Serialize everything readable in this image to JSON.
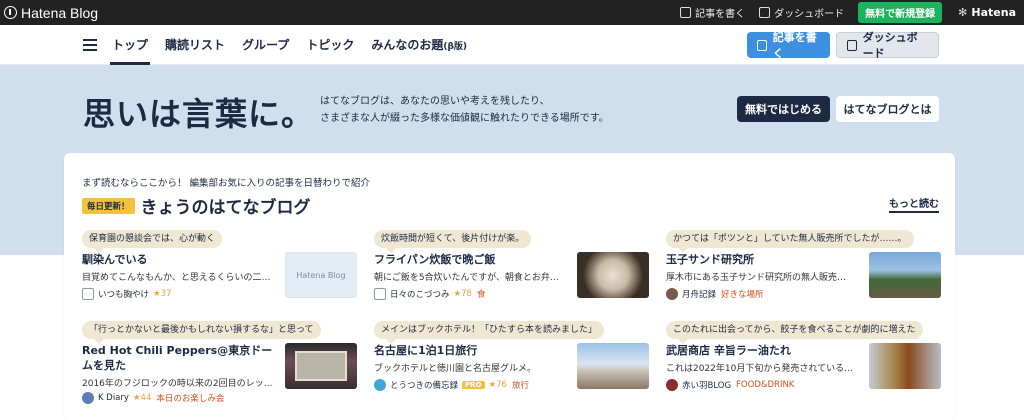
{
  "topbar": {
    "logo": "Hatena Blog",
    "write": "記事を書く",
    "dashboard": "ダッシュボード",
    "register": "無料で新規登録",
    "hatena": "Hatena"
  },
  "nav": {
    "tabs": [
      {
        "label": "トップ"
      },
      {
        "label": "購読リスト"
      },
      {
        "label": "グループ"
      },
      {
        "label": "トピック"
      },
      {
        "label": "みんなのお題",
        "suffix": "(β版)"
      }
    ],
    "write_btn": "記事を書く",
    "dash_btn": "ダッシュボード"
  },
  "hero": {
    "title": "思いは言葉に。",
    "desc1": "はてなブログは、あなたの思いや考えを残したり、",
    "desc2": "さまざまな人が綴った多様な価値観に触れたりできる場所です。",
    "btn_free": "無料ではじめる",
    "btn_about": "はてなブログとは"
  },
  "featured": {
    "intro": "まず読むならここから！ 編集部お気に入りの記事を日替わりで紹介",
    "badge": "毎日更新！",
    "heading": "きょうのはてなブログ",
    "more": "もっと読む",
    "entries": [
      {
        "comment": "保育園の懇談会では、心が動く",
        "title": "馴染んでいる",
        "desc": "目覚めてこんなもんか、と思えるくらいの二…",
        "blog": "いつも胸やけ",
        "stars": "★37",
        "pro": "",
        "category": "",
        "thumb": "Hatena Blog"
      },
      {
        "comment": "炊飯時間が短くて、後片付けが楽。",
        "title": "フライパン炊飯で晩ご飯",
        "desc": "朝にご飯を5合炊いたんですが、朝食とお弁…",
        "blog": "日々のこづつみ",
        "stars": "★78",
        "pro": "",
        "category": "食",
        "thumb": ""
      },
      {
        "comment": "かつては「ポツンと」していた無人販売所でしたが……。",
        "title": "玉子サンド研究所",
        "desc": "厚木市にある玉子サンド研究所の無人販売…",
        "blog": "月舟記録",
        "stars": "",
        "pro": "",
        "category": "好きな場所",
        "thumb": ""
      },
      {
        "comment": "「行っとかないと最後かもしれない損するな」と思って",
        "title": "Red Hot Chili Peppers@東京ドームを見た",
        "desc": "2016年のフジロックの時以来の2回目のレッ…",
        "blog": "K Diary",
        "stars": "★44",
        "pro": "",
        "category": "本日のお楽しみ会",
        "thumb": ""
      },
      {
        "comment": "メインはブックホテル！「ひたすら本を読みました」",
        "title": "名古屋に1泊1日旅行",
        "desc": "ブックホテルと徳川園と名古屋グルメ。",
        "blog": "とうつきの備忘録",
        "stars": "★76",
        "pro": "PRO",
        "category": "旅行",
        "thumb": ""
      },
      {
        "comment": "このたれに出会ってから、餃子を食べることが劇的に増えた",
        "title": "武居商店 辛旨ラー油たれ",
        "desc": "これは2022年10月下旬から発売されている…",
        "blog": "赤い羽BLOG",
        "stars": "",
        "pro": "",
        "category": "FOOD&DRINK",
        "thumb": ""
      }
    ]
  },
  "colors": {
    "navy": "#1c2a44",
    "hero_bg": "#cfdfee",
    "green": "#1bb35b",
    "blue": "#3d8fe0",
    "star": "#e8a33d",
    "category": "#d0501c"
  }
}
